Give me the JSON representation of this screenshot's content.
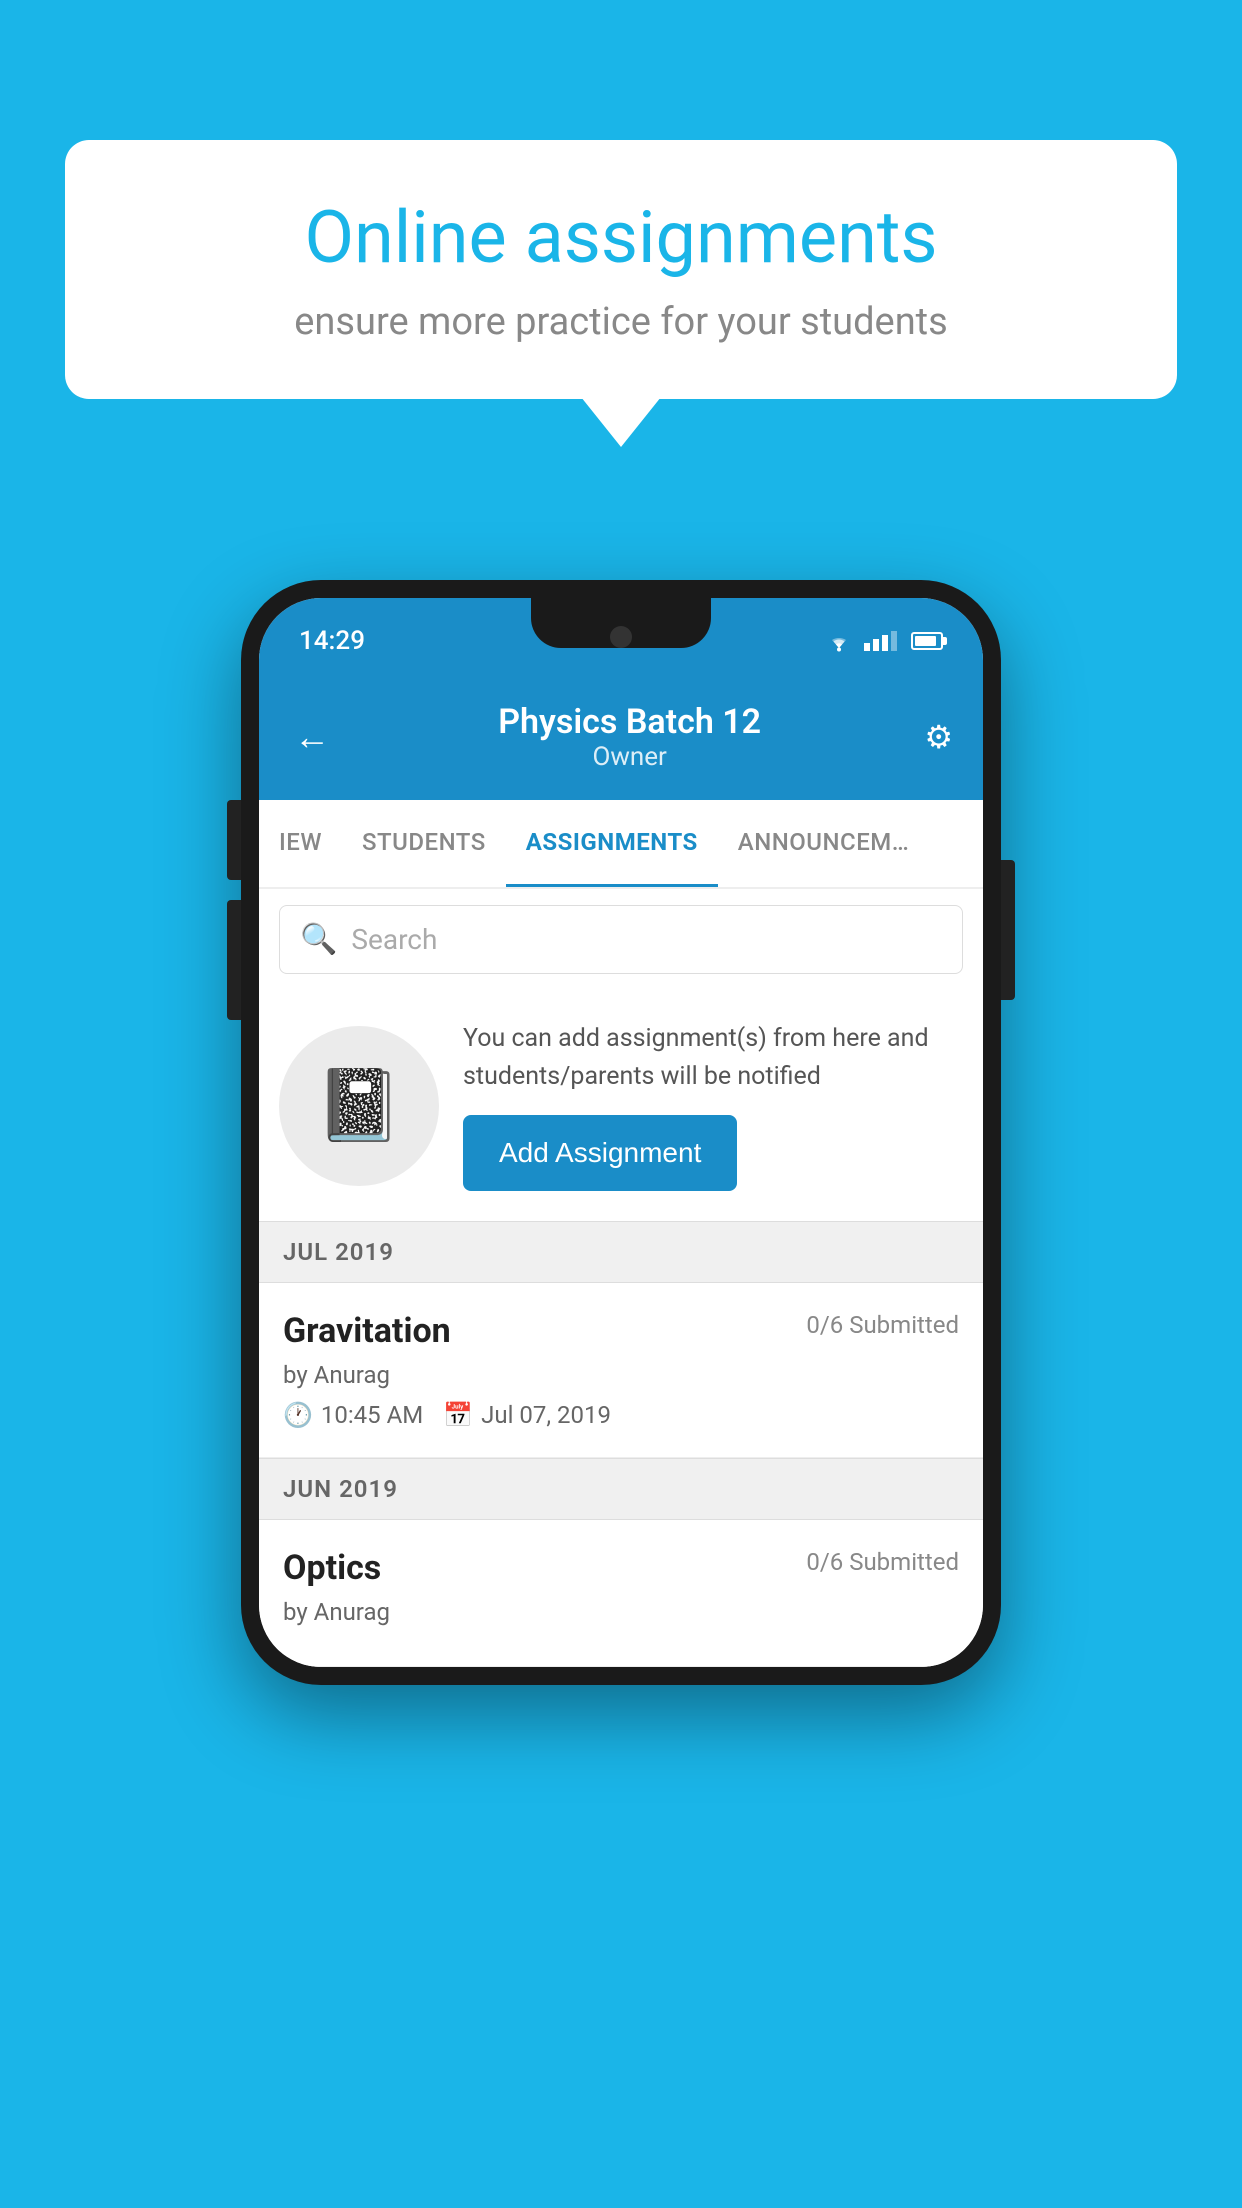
{
  "background_color": "#1ab5e8",
  "speech_bubble": {
    "title": "Online assignments",
    "subtitle": "ensure more practice for your students"
  },
  "status_bar": {
    "time": "14:29"
  },
  "app_bar": {
    "title": "Physics Batch 12",
    "subtitle": "Owner",
    "back_label": "←",
    "settings_label": "⚙"
  },
  "tabs": [
    {
      "label": "IEW",
      "active": false
    },
    {
      "label": "STUDENTS",
      "active": false
    },
    {
      "label": "ASSIGNMENTS",
      "active": true
    },
    {
      "label": "ANNOUNCEM…",
      "active": false
    }
  ],
  "search": {
    "placeholder": "Search"
  },
  "add_assignment": {
    "description": "You can add assignment(s) from here and students/parents will be notified",
    "button_label": "Add Assignment"
  },
  "sections": [
    {
      "header": "JUL 2019",
      "items": [
        {
          "name": "Gravitation",
          "submitted": "0/6 Submitted",
          "author": "by Anurag",
          "time": "10:45 AM",
          "date": "Jul 07, 2019"
        }
      ]
    },
    {
      "header": "JUN 2019",
      "items": [
        {
          "name": "Optics",
          "submitted": "0/6 Submitted",
          "author": "by Anurag",
          "time": "",
          "date": ""
        }
      ]
    }
  ]
}
